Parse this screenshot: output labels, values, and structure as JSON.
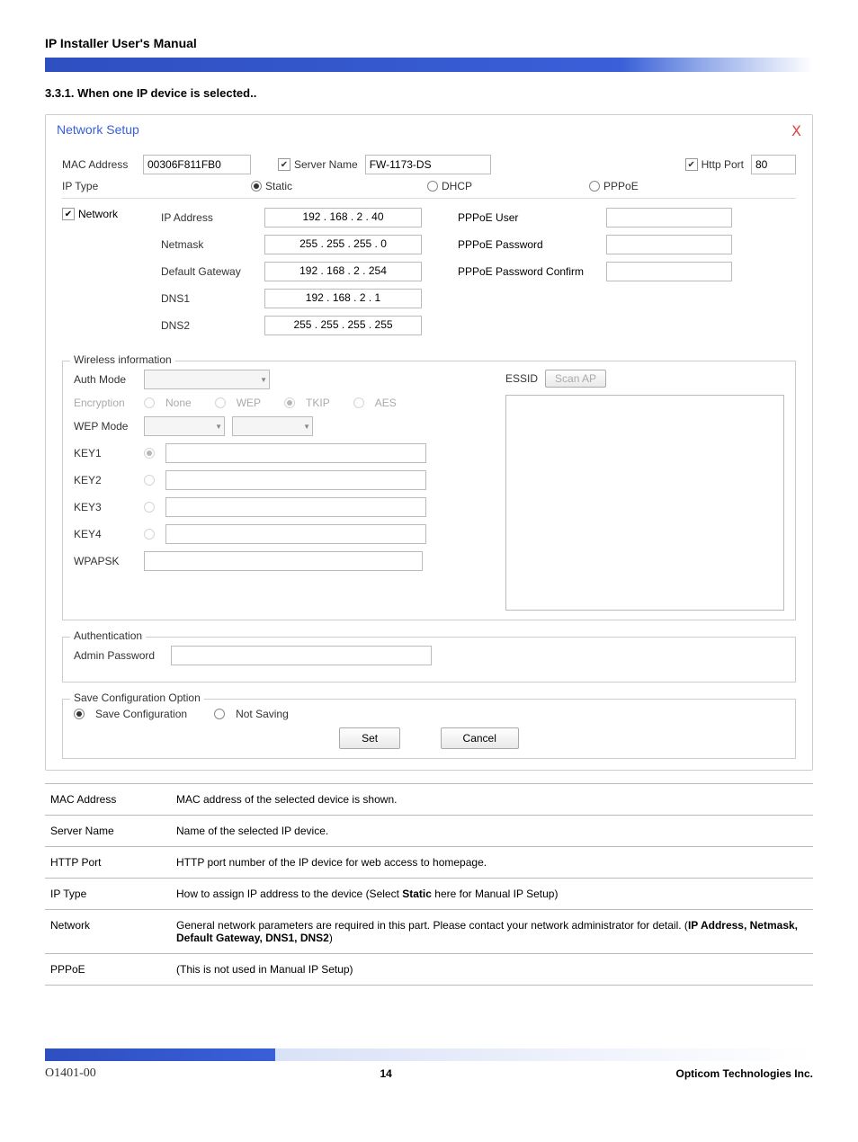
{
  "header": {
    "title": "IP Installer User's Manual",
    "section": "3.3.1.   When one IP device is selected.."
  },
  "dialog": {
    "title": "Network Setup",
    "mac_label": "MAC Address",
    "mac_value": "00306F811FB0",
    "server_name_check": "Server Name",
    "server_name_value": "FW-1173-DS",
    "http_port_check": "Http Port",
    "http_port_value": "80",
    "ip_type_label": "IP Type",
    "ip_type_static": "Static",
    "ip_type_dhcp": "DHCP",
    "ip_type_pppoe": "PPPoE",
    "network_check": "Network",
    "ip_address_label": "IP Address",
    "ip_address_value": "192  .  168  .   2   .   40",
    "netmask_label": "Netmask",
    "netmask_value": "255  .  255  .  255  .   0",
    "gateway_label": "Default Gateway",
    "gateway_value": "192  .  168  .   2   .  254",
    "dns1_label": "DNS1",
    "dns1_value": "192  .  168  .   2   .   1",
    "dns2_label": "DNS2",
    "dns2_value": "255  .  255  .  255  .  255",
    "pppoe_user_label": "PPPoE User",
    "pppoe_pass_label": "PPPoE Password",
    "pppoe_conf_label": "PPPoE Password Confirm",
    "wireless_title": "Wireless information",
    "auth_mode": "Auth Mode",
    "encryption": "Encryption",
    "enc_none": "None",
    "enc_wep": "WEP",
    "enc_tkip": "TKIP",
    "enc_aes": "AES",
    "wep_mode": "WEP Mode",
    "key1": "KEY1",
    "key2": "KEY2",
    "key3": "KEY3",
    "key4": "KEY4",
    "wpapsk": "WPAPSK",
    "essid": "ESSID",
    "scan_ap": "Scan AP",
    "auth_title": "Authentication",
    "admin_pass": "Admin Password",
    "save_title": "Save Configuration Option",
    "save_config": "Save Configuration",
    "not_saving": "Not Saving",
    "set_btn": "Set",
    "cancel_btn": "Cancel"
  },
  "table": {
    "r1c1": "MAC Address",
    "r1c2": "MAC address of the selected device is shown.",
    "r2c1": "Server Name",
    "r2c2": "Name of the selected IP device.",
    "r3c1": "HTTP Port",
    "r3c2": "HTTP port number of the IP device for web access to homepage.",
    "r4c1": "IP Type",
    "r4c2_a": "How to assign IP address to the device (Select ",
    "r4c2_b": "Static",
    "r4c2_c": " here for Manual IP Setup)",
    "r5c1": "Network",
    "r5c2_a": "General network parameters are required in this part. Please contact your network administrator for detail. (",
    "r5c2_b": "IP Address, Netmask, Default Gateway, DNS1, DNS2",
    "r5c2_c": ")",
    "r6c1": "PPPoE",
    "r6c2": "(This is not used in Manual IP Setup)"
  },
  "footer": {
    "left": "O1401-00",
    "center": "14",
    "right": "Opticom Technologies Inc."
  }
}
